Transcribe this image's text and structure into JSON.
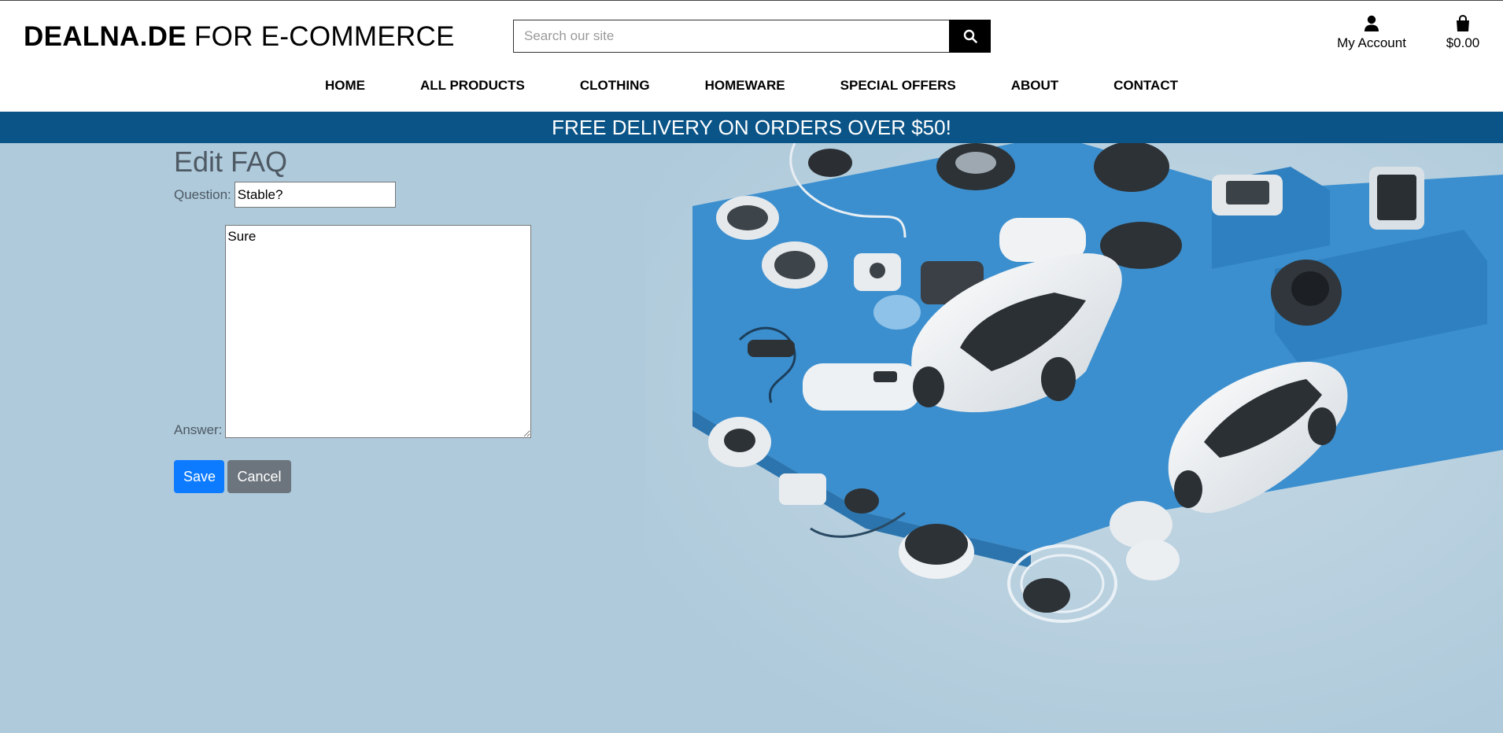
{
  "brand": {
    "bold": "DEALNA.DE",
    "rest": " FOR E-COMMERCE"
  },
  "search": {
    "placeholder": "Search our site",
    "value": "",
    "icon": "search-icon"
  },
  "account": {
    "label": "My Account",
    "icon": "user-icon"
  },
  "cart": {
    "total": "$0.00",
    "icon": "shopping-bag-icon"
  },
  "nav": [
    "HOME",
    "ALL PRODUCTS",
    "CLOTHING",
    "HOMEWARE",
    "SPECIAL OFFERS",
    "ABOUT",
    "CONTACT"
  ],
  "banner": "FREE DELIVERY ON ORDERS OVER $50!",
  "form": {
    "title": "Edit FAQ",
    "question_label": "Question:",
    "question_value": "Stable?",
    "answer_label": "Answer:",
    "answer_value": "Sure",
    "save_label": "Save",
    "cancel_label": "Cancel"
  },
  "colors": {
    "banner": "#0b5487",
    "background": "#aecadb",
    "save": "#0d7bff",
    "cancel": "#6c757d",
    "platform": "#3b8fcf"
  }
}
